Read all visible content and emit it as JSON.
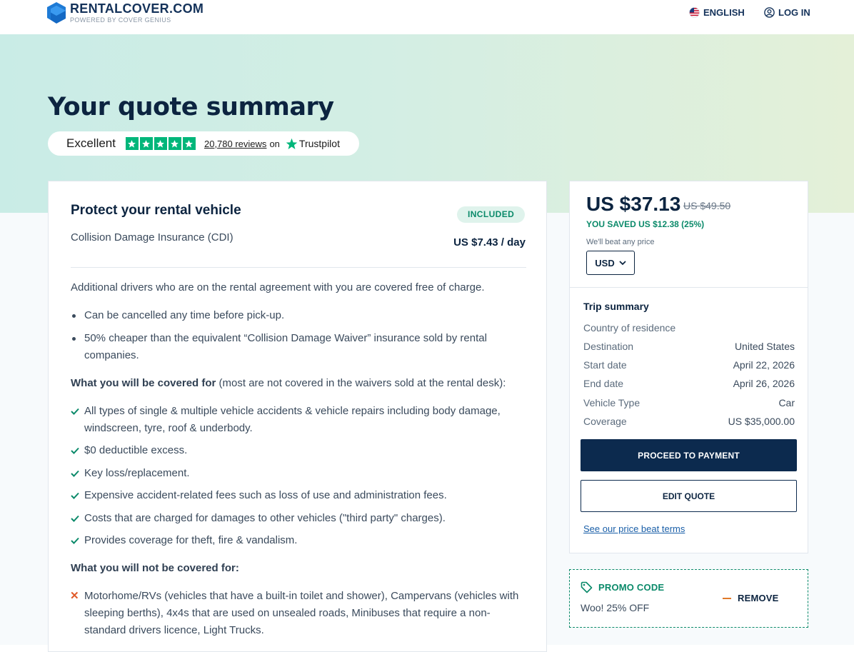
{
  "header": {
    "brand": "RENTALCOVER.COM",
    "brand_sub": "POWERED BY COVER GENIUS",
    "language": "ENGLISH",
    "login": "LOG IN"
  },
  "hero": {
    "title": "Your quote summary",
    "trustpilot": {
      "rating_word": "Excellent",
      "stars": 5,
      "review_count": "20,780 reviews",
      "on_text": "on",
      "brand": "Trustpilot"
    }
  },
  "product": {
    "title": "Protect your rental vehicle",
    "subtitle": "Collision Damage Insurance (CDI)",
    "badge": "INCLUDED",
    "price_per_day": "US $7.43 / day",
    "intro": "Additional drivers who are on the rental agreement with you are covered free of charge.",
    "bullets": [
      "Can be cancelled any time before pick-up.",
      "50% cheaper than the equivalent “Collision Damage Waiver” insurance sold by rental companies."
    ],
    "covered_heading": "What you will be covered for",
    "covered_note": " (most are not covered in the waivers sold at the rental desk):",
    "covered": [
      "All types of single & multiple vehicle accidents & vehicle repairs including body damage, windscreen, tyre, roof & underbody.",
      "$0 deductible excess.",
      "Key loss/replacement.",
      "Expensive accident-related fees such as loss of use and administration fees.",
      "Costs that are charged for damages to other vehicles (\"third party\" charges).",
      "Provides coverage for theft, fire & vandalism."
    ],
    "not_covered_heading": "What you will not be covered for:",
    "not_covered": [
      "Motorhome/RVs (vehicles that have a built-in toilet and shower), Campervans (vehicles with sleeping berths), 4x4s that are used on unsealed roads, Minibuses that require a non-standard drivers licence, Light Trucks."
    ]
  },
  "summary": {
    "price": "US $37.13",
    "original_price": "US $49.50",
    "saved": "YOU SAVED US $12.38 (25%)",
    "beat_text": "We'll beat any price",
    "currency": "USD",
    "trip_title": "Trip summary",
    "rows": [
      {
        "label": "Country of residence",
        "value": ""
      },
      {
        "label": "Destination",
        "value": "United States"
      },
      {
        "label": "Start date",
        "value": "April 22, 2026"
      },
      {
        "label": "End date",
        "value": "April 26, 2026"
      },
      {
        "label": "Vehicle Type",
        "value": "Car"
      },
      {
        "label": "Coverage",
        "value": "US $35,000.00"
      }
    ],
    "proceed_button": "PROCEED TO PAYMENT",
    "edit_button": "EDIT QUOTE",
    "terms_link": "See our price beat terms"
  },
  "promo": {
    "label": "PROMO CODE",
    "value": "Woo! 25% OFF",
    "remove": "REMOVE"
  },
  "colors": {
    "navy": "#0c2440",
    "green": "#0b8a6a",
    "trustpilot_green": "#00b67a",
    "orange": "#e05a2a"
  }
}
